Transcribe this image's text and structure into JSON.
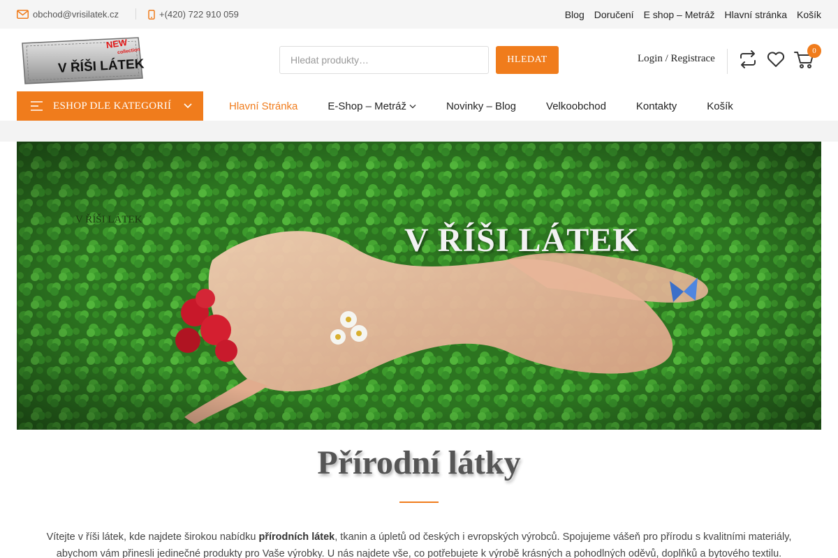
{
  "topbar": {
    "email": "obchod@vrisilatek.cz",
    "phone": "+(420) 722 910 059",
    "links": [
      "Blog",
      "Doručení",
      "E shop – Metráž",
      "Hlavní stránka",
      "Košík"
    ]
  },
  "header": {
    "logo": {
      "text": "V ŘÍŠI LÁTEK",
      "badge_line1": "NEW",
      "badge_line2": "collection"
    },
    "search": {
      "placeholder": "Hledat produkty…",
      "button": "HLEDAT"
    },
    "login": "Login",
    "login_sep": "/",
    "register": "Registrace",
    "cart_count": "0",
    "icons": [
      "compare-icon",
      "heart-icon",
      "cart-icon"
    ]
  },
  "nav": {
    "category_button": "ESHOP DLE KATEGORIÍ",
    "items": [
      {
        "label": "Hlavní Stránka",
        "active": true
      },
      {
        "label": "E-Shop – Metráž",
        "dropdown": true
      },
      {
        "label": "Novinky – Blog"
      },
      {
        "label": "Velkoobchod"
      },
      {
        "label": "Kontakty"
      },
      {
        "label": "Košík"
      }
    ]
  },
  "hero": {
    "breadcrumb": "V ŘÍŠI LÁTEK",
    "title": "V ŘÍŠI LÁTEK"
  },
  "content": {
    "title": "Přírodní látky",
    "intro_pre": "Vítejte v říši látek, kde najdete širokou nabídku ",
    "intro_bold": "přírodních látek",
    "intro_post": ", tkanin a úpletů od českých i evropských výrobců. Spojujeme vášeň pro přírodu s kvalitními materiály, abychom vám přinesli jedinečné produkty pro Vaše výrobky. U nás najdete vše, co potřebujete k výrobě krásných a pohodlných oděvů, doplňků a bytového textilu."
  },
  "colors": {
    "accent": "#f07c1c",
    "topbar_bg": "#f5f5f5",
    "hero_green": "#2f7a22"
  }
}
